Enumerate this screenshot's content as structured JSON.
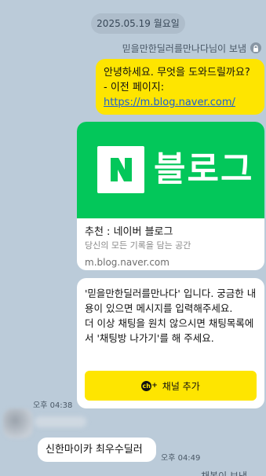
{
  "date_divider": "2025.05.19 월요일",
  "sent_by": "믿을만한딜러를만나다님이 보냄",
  "bot_message": {
    "line1": "안녕하세요. 무엇을 도와드릴까요?",
    "line2": "- 이전 페이지:",
    "link": "https://m.blog.naver.com/"
  },
  "link_card": {
    "banner_text": "블로그",
    "logo_letter": "N",
    "title": "추천 : 네이버 블로그",
    "subtitle": "당신의 모든 기록을 담는 공간",
    "domain": "m.blog.naver.com"
  },
  "info_card": {
    "text": "'믿을만한딜러를만나다' 입니다. 궁금한 내용이 있으면 메시지를 입력해주세요.\n더 이상 채팅을 원치 않으시면 채팅목록에서 '채팅방 나가기'를 해 주세요.",
    "button_label": "채널 추가",
    "button_icon_text": "ch",
    "button_icon_plus": "+"
  },
  "time_bot": "오후 04:38",
  "user_message": "신한마이카 최우수딜러",
  "time_user": "오후 04:49",
  "bottom_sender_partial": "채봇이 보낸",
  "colors": {
    "background": "#bbcbd9",
    "kakao_yellow": "#fee500",
    "naver_green": "#03c75a"
  }
}
